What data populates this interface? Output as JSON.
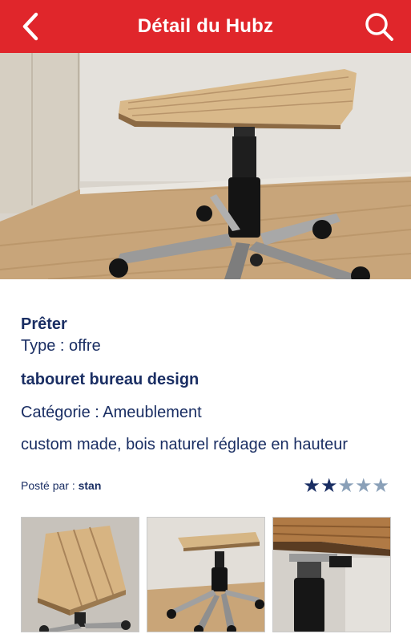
{
  "header": {
    "title": "Détail du Hubz"
  },
  "listing": {
    "action": "Prêter",
    "type": "Type : offre",
    "name": "tabouret bureau design",
    "category": "Catégorie : Ameublement",
    "description": "custom made, bois naturel réglage en hauteur",
    "posted_label": "Posté par : ",
    "posted_by": "stan",
    "rating": 2,
    "rating_max": 5
  },
  "colors": {
    "header_bg": "#e0262b",
    "text": "#1a2e63",
    "star_on": "#1a2e63",
    "star_off": "#8aa0b8"
  },
  "icons": {
    "back": "chevron-left-icon",
    "search": "search-icon"
  }
}
